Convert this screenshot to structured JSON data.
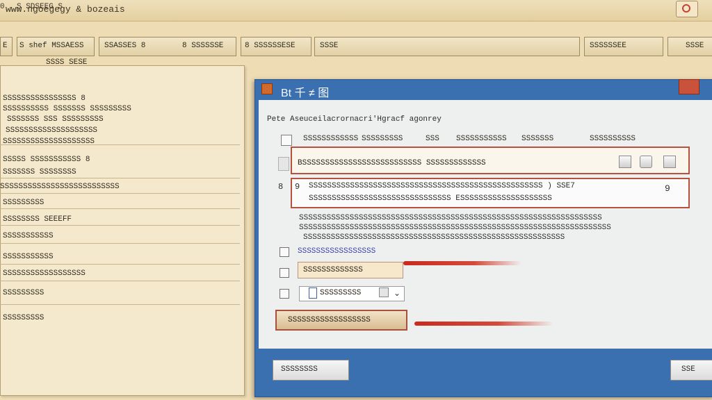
{
  "window": {
    "title": "www.ngoegegy & bozeais"
  },
  "menubar": {
    "marker": "0",
    "label": "S SDSEEG S"
  },
  "toolbar": {
    "items": [
      {
        "label": "E"
      },
      {
        "label": "S shef MSSAESS"
      },
      {
        "label": "SSASSES 8"
      },
      {
        "label": "8 SSSSSSE"
      },
      {
        "label": "8 SSSSSSESE"
      },
      {
        "label": "SSSE"
      },
      {
        "label": "SSSSSSEE"
      },
      {
        "label": "SSSE"
      }
    ]
  },
  "left_panel": {
    "header": "SSSS SESE",
    "rows": [
      "SSSSSSSSSSSSSSSS 8",
      "SSSSSSSSSS SSSSSSS SSSSSSSSS",
      "SSSSSSS SSS SSSSSSSSS",
      "SSSSSSSSSSSSSSSSSSSS",
      "SSSSSSSSSSSSSSSSSSSS",
      "SSSSS SSSSSSSSSSS 8",
      "SSSSSSS SSSSSSSS",
      "SSSSSSSSSSSSSSSSSSSSSSSSSS",
      "SSSSSSSSS",
      "SSSSSSSS SEEEFF",
      "SSSSSSSSSSS",
      "SSSSSSSSSSS",
      "SSSSSSSSSSSSSSSSSS",
      "SSSSSSSSS",
      "SSSSSSSSS"
    ]
  },
  "dialog": {
    "title": "Bt 千 ≠ 图",
    "description": "Pete Aseuceilacrornacri'Hgracf agonrey",
    "columns": [
      "SSSSSSSSSSSS",
      "SSSSSSSSS",
      "SSS",
      "SSSSSSSSSSS",
      "SSSSSSS",
      "SSSSSSSSSS"
    ],
    "search": {
      "text": "BSSSSSSSSSSSSSSSSSSSSSSSSSS SSSSSSSSSSSSS"
    },
    "list": {
      "marker": "9",
      "side_marker": "8",
      "line1": "SSSSSSSSSSSSSSSSSSSSSSSSSSSSSSSSSSSSSSSSSSSSSSSSSSS ) SSE7",
      "line2": "SSSSSSSSSSSSSSSSSSSSSSSSSSSSSSS ESSSSSSSSSSSSSSSSSSSS",
      "number": "9"
    },
    "notes": [
      "SSSSSSSSSSSSSSSSSSSSSSSSSSSSSSSSSSSSSSSSSSSSSSSSSSSSSSSSSSSSSSSSSS",
      "SSSSSSSSSSSSSSSSSSSSSSSSSSSSSSSSSSSSSSSSSSSSSSSSSSSSSSSSSSSSSSSSSSSS",
      "SSSSSSSSSSSSSSSSSSSSSSSSSSSSSSSSSSSSSSSSSSSSSSSSSSSSSSSSS"
    ],
    "link_text": "SSSSSSSSSSSSSSSSS",
    "field1_value": "SSSSSSSSSSSSS",
    "field2_value": "SSSSSSSSS",
    "primary_button": "SSSSSSSSSSSSSSSSSS",
    "footer_left_button": "SSSSSSSS",
    "footer_right_button": "SSE"
  },
  "colors": {
    "accent_red": "#c92a1e",
    "dialog_blue": "#3a6fb0",
    "panel_tan": "#f4e8cd"
  }
}
